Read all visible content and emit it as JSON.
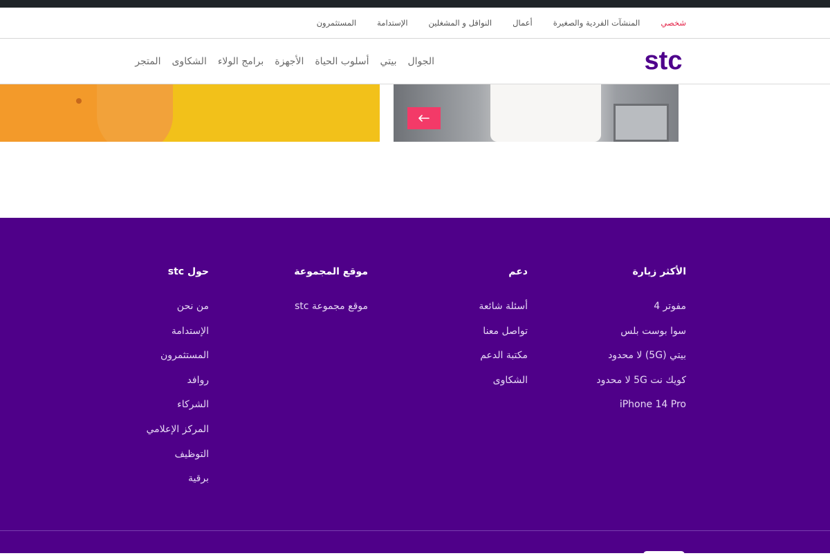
{
  "segments": {
    "items": [
      {
        "label": "شخصي",
        "active": true
      },
      {
        "label": "المنشآت الفردية والصغيرة",
        "active": false
      },
      {
        "label": "أعمال",
        "active": false
      },
      {
        "label": "النواقل و المشغلين",
        "active": false
      },
      {
        "label": "الإستدامة",
        "active": false
      },
      {
        "label": "المستثمرون",
        "active": false
      }
    ]
  },
  "brand": {
    "logo_text": "stc",
    "logo_color": "#4f008c"
  },
  "main_nav": {
    "items": [
      {
        "label": "الجوال"
      },
      {
        "label": "بيتي"
      },
      {
        "label": "أسلوب الحياة"
      },
      {
        "label": "الأجهزة"
      },
      {
        "label": "برامج الولاء"
      },
      {
        "label": "الشكاوى"
      },
      {
        "label": "المتجر"
      }
    ]
  },
  "carousel": {
    "arrow_icon": "arrow-left-icon",
    "arrow_glyph": "←",
    "arrow_color": "#f33a68"
  },
  "footer": {
    "background": "#4f0089",
    "columns": [
      {
        "title": "الأكثر زيارة",
        "links": [
          "مفوتر 4",
          "سوا بوست بلس",
          "بيتي (5G) لا محدود",
          "كويك نت 5G لا محدود",
          "iPhone 14 Pro"
        ]
      },
      {
        "title": "دعم",
        "links": [
          "أسئلة شائعة",
          "تواصل معنا",
          "مكتبة الدعم",
          "الشكاوى"
        ]
      },
      {
        "title": "موقع المجموعة",
        "links": [
          "موقع مجموعة stc"
        ]
      },
      {
        "title": "حول stc",
        "links": [
          "من نحن",
          "الإستدامة",
          "المستثمرون",
          "روافد",
          "الشركاء",
          "المركز الإعلامي",
          "التوظيف",
          "برقية"
        ]
      }
    ]
  }
}
